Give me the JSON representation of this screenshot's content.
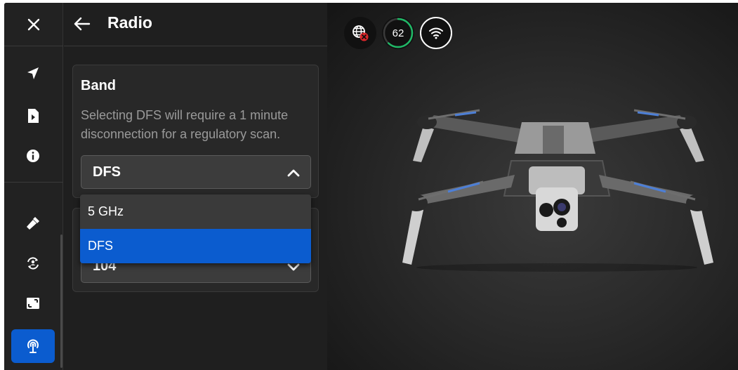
{
  "header": {
    "title": "Radio"
  },
  "band": {
    "title": "Band",
    "description": "Selecting DFS will require a 1 minute disconnection for a regulatory scan.",
    "selected_value": "DFS",
    "options": [
      "5 GHz",
      "DFS"
    ]
  },
  "channel": {
    "value": "104"
  },
  "status": {
    "battery_percent": "62"
  },
  "colors": {
    "accent": "#0b5ccf",
    "battery_ring": "#1fb866",
    "error_badge": "#d9262a"
  },
  "icons": {
    "rail": [
      "close-icon",
      "navigation-arrow-icon",
      "flight-log-icon",
      "info-icon",
      "flashlight-icon",
      "sync-icon",
      "aspect-ratio-icon",
      "radio-antenna-icon"
    ],
    "status": [
      "globe-error-icon",
      "battery-ring",
      "wifi-icon"
    ]
  }
}
